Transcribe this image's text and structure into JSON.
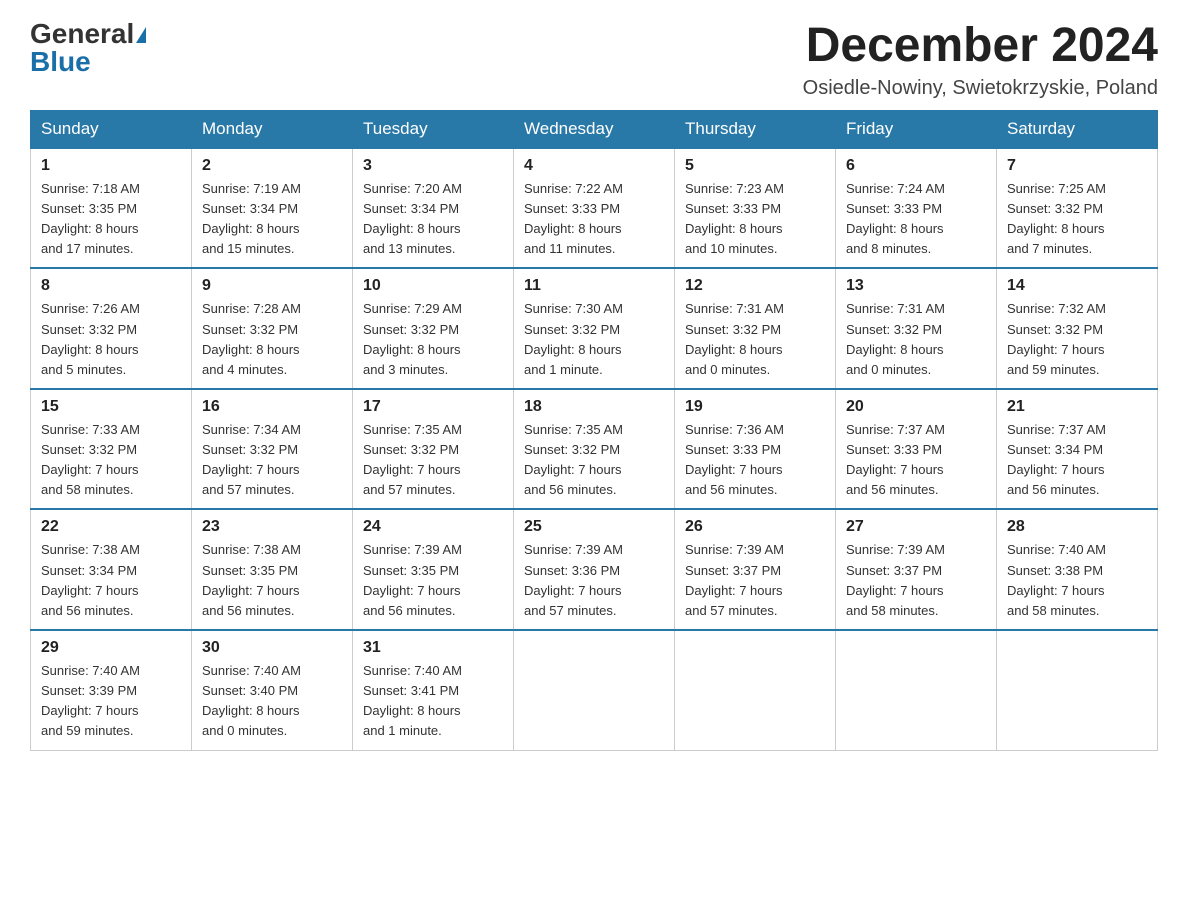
{
  "header": {
    "logo_general": "General",
    "logo_blue": "Blue",
    "month_title": "December 2024",
    "location": "Osiedle-Nowiny, Swietokrzyskie, Poland"
  },
  "days_of_week": [
    "Sunday",
    "Monday",
    "Tuesday",
    "Wednesday",
    "Thursday",
    "Friday",
    "Saturday"
  ],
  "weeks": [
    [
      {
        "day": "1",
        "info": "Sunrise: 7:18 AM\nSunset: 3:35 PM\nDaylight: 8 hours\nand 17 minutes."
      },
      {
        "day": "2",
        "info": "Sunrise: 7:19 AM\nSunset: 3:34 PM\nDaylight: 8 hours\nand 15 minutes."
      },
      {
        "day": "3",
        "info": "Sunrise: 7:20 AM\nSunset: 3:34 PM\nDaylight: 8 hours\nand 13 minutes."
      },
      {
        "day": "4",
        "info": "Sunrise: 7:22 AM\nSunset: 3:33 PM\nDaylight: 8 hours\nand 11 minutes."
      },
      {
        "day": "5",
        "info": "Sunrise: 7:23 AM\nSunset: 3:33 PM\nDaylight: 8 hours\nand 10 minutes."
      },
      {
        "day": "6",
        "info": "Sunrise: 7:24 AM\nSunset: 3:33 PM\nDaylight: 8 hours\nand 8 minutes."
      },
      {
        "day": "7",
        "info": "Sunrise: 7:25 AM\nSunset: 3:32 PM\nDaylight: 8 hours\nand 7 minutes."
      }
    ],
    [
      {
        "day": "8",
        "info": "Sunrise: 7:26 AM\nSunset: 3:32 PM\nDaylight: 8 hours\nand 5 minutes."
      },
      {
        "day": "9",
        "info": "Sunrise: 7:28 AM\nSunset: 3:32 PM\nDaylight: 8 hours\nand 4 minutes."
      },
      {
        "day": "10",
        "info": "Sunrise: 7:29 AM\nSunset: 3:32 PM\nDaylight: 8 hours\nand 3 minutes."
      },
      {
        "day": "11",
        "info": "Sunrise: 7:30 AM\nSunset: 3:32 PM\nDaylight: 8 hours\nand 1 minute."
      },
      {
        "day": "12",
        "info": "Sunrise: 7:31 AM\nSunset: 3:32 PM\nDaylight: 8 hours\nand 0 minutes."
      },
      {
        "day": "13",
        "info": "Sunrise: 7:31 AM\nSunset: 3:32 PM\nDaylight: 8 hours\nand 0 minutes."
      },
      {
        "day": "14",
        "info": "Sunrise: 7:32 AM\nSunset: 3:32 PM\nDaylight: 7 hours\nand 59 minutes."
      }
    ],
    [
      {
        "day": "15",
        "info": "Sunrise: 7:33 AM\nSunset: 3:32 PM\nDaylight: 7 hours\nand 58 minutes."
      },
      {
        "day": "16",
        "info": "Sunrise: 7:34 AM\nSunset: 3:32 PM\nDaylight: 7 hours\nand 57 minutes."
      },
      {
        "day": "17",
        "info": "Sunrise: 7:35 AM\nSunset: 3:32 PM\nDaylight: 7 hours\nand 57 minutes."
      },
      {
        "day": "18",
        "info": "Sunrise: 7:35 AM\nSunset: 3:32 PM\nDaylight: 7 hours\nand 56 minutes."
      },
      {
        "day": "19",
        "info": "Sunrise: 7:36 AM\nSunset: 3:33 PM\nDaylight: 7 hours\nand 56 minutes."
      },
      {
        "day": "20",
        "info": "Sunrise: 7:37 AM\nSunset: 3:33 PM\nDaylight: 7 hours\nand 56 minutes."
      },
      {
        "day": "21",
        "info": "Sunrise: 7:37 AM\nSunset: 3:34 PM\nDaylight: 7 hours\nand 56 minutes."
      }
    ],
    [
      {
        "day": "22",
        "info": "Sunrise: 7:38 AM\nSunset: 3:34 PM\nDaylight: 7 hours\nand 56 minutes."
      },
      {
        "day": "23",
        "info": "Sunrise: 7:38 AM\nSunset: 3:35 PM\nDaylight: 7 hours\nand 56 minutes."
      },
      {
        "day": "24",
        "info": "Sunrise: 7:39 AM\nSunset: 3:35 PM\nDaylight: 7 hours\nand 56 minutes."
      },
      {
        "day": "25",
        "info": "Sunrise: 7:39 AM\nSunset: 3:36 PM\nDaylight: 7 hours\nand 57 minutes."
      },
      {
        "day": "26",
        "info": "Sunrise: 7:39 AM\nSunset: 3:37 PM\nDaylight: 7 hours\nand 57 minutes."
      },
      {
        "day": "27",
        "info": "Sunrise: 7:39 AM\nSunset: 3:37 PM\nDaylight: 7 hours\nand 58 minutes."
      },
      {
        "day": "28",
        "info": "Sunrise: 7:40 AM\nSunset: 3:38 PM\nDaylight: 7 hours\nand 58 minutes."
      }
    ],
    [
      {
        "day": "29",
        "info": "Sunrise: 7:40 AM\nSunset: 3:39 PM\nDaylight: 7 hours\nand 59 minutes."
      },
      {
        "day": "30",
        "info": "Sunrise: 7:40 AM\nSunset: 3:40 PM\nDaylight: 8 hours\nand 0 minutes."
      },
      {
        "day": "31",
        "info": "Sunrise: 7:40 AM\nSunset: 3:41 PM\nDaylight: 8 hours\nand 1 minute."
      },
      null,
      null,
      null,
      null
    ]
  ]
}
